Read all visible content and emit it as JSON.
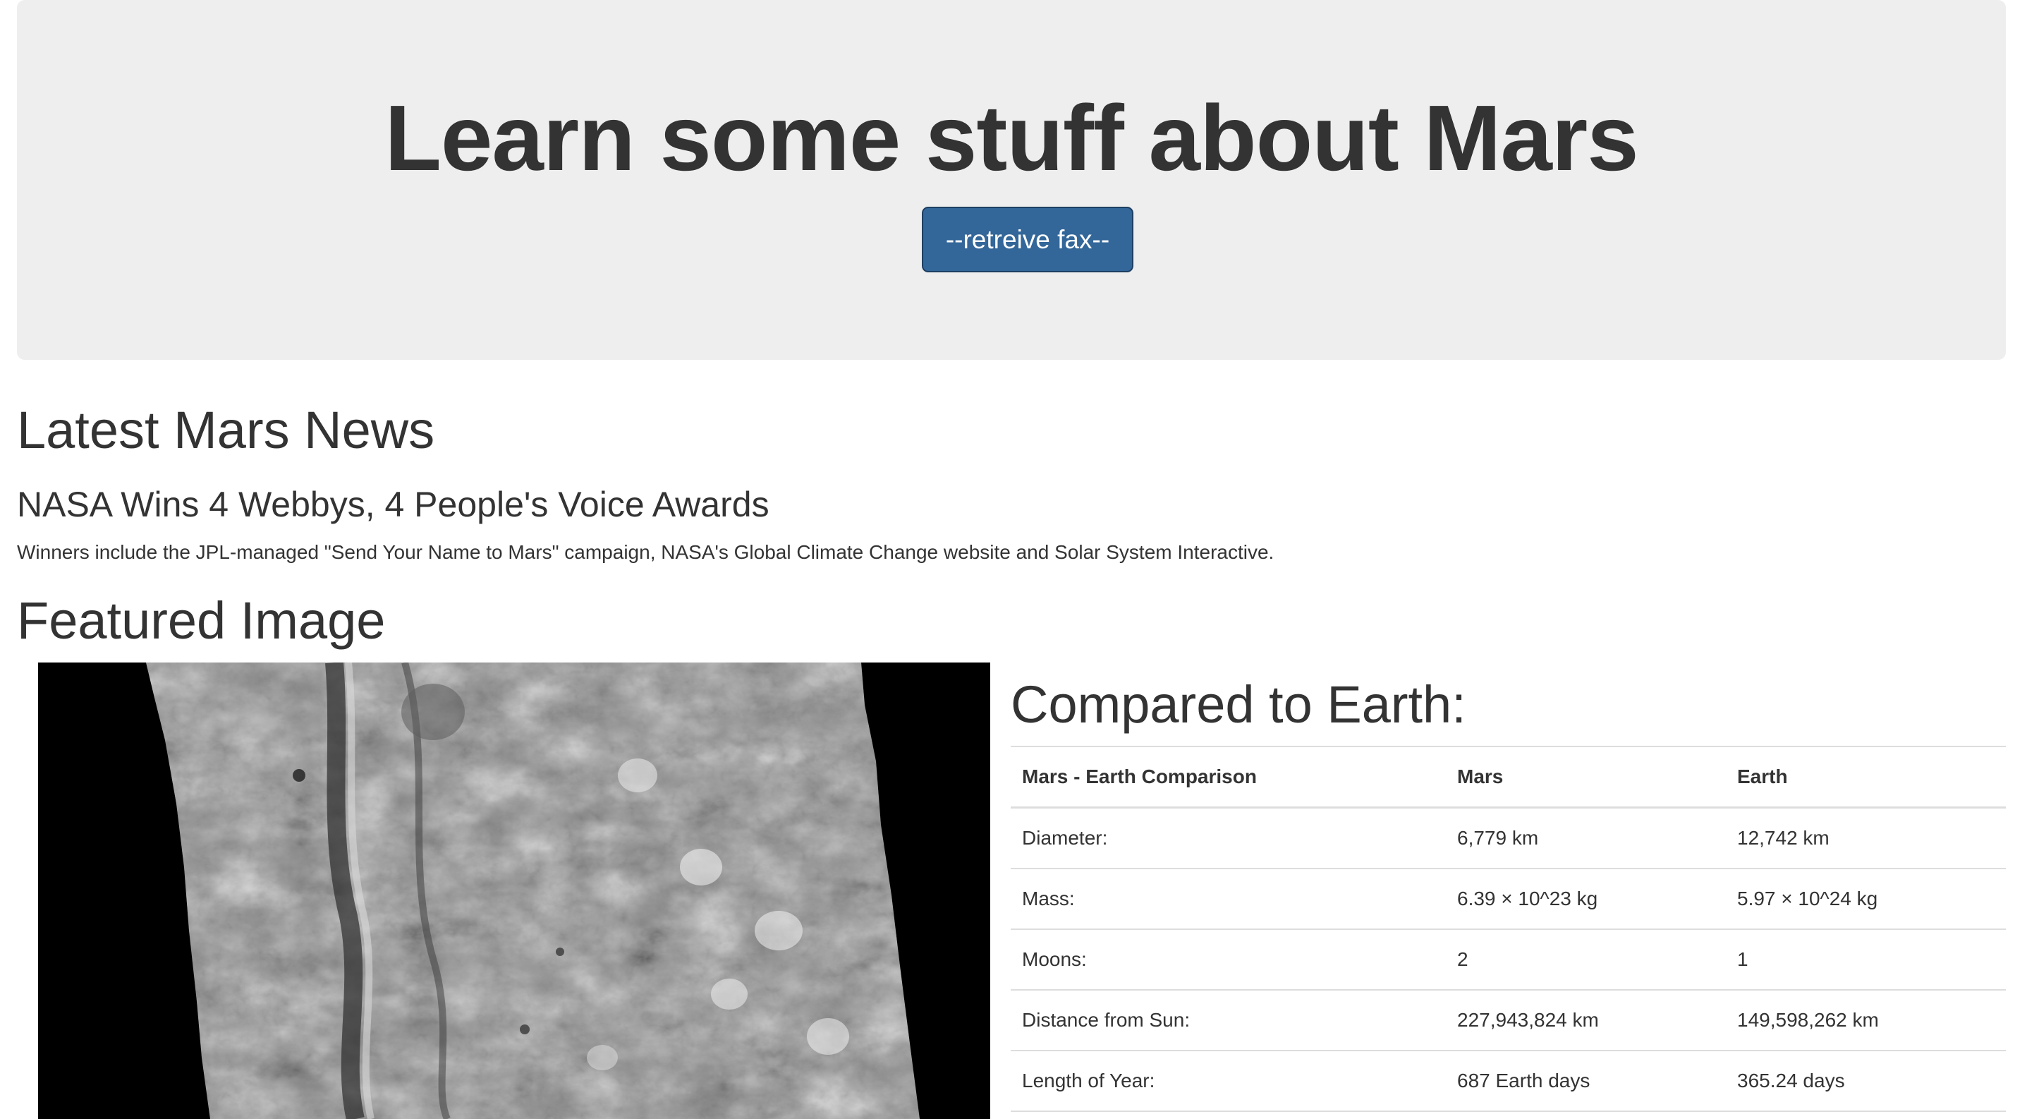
{
  "jumbotron": {
    "title": "Learn some stuff about Mars",
    "button_label": "--retreive fax--",
    "button_color": "#336699",
    "background": "#eeeeee"
  },
  "news": {
    "section_title": "Latest Mars News",
    "headline": "NASA Wins 4 Webbys, 4 People's Voice Awards",
    "teaser": "Winners include the JPL-managed \"Send Your Name to Mars\" campaign, NASA's Global Climate Change website and Solar System Interactive."
  },
  "featured": {
    "section_title": "Featured Image",
    "image_subject": "grayscale-mars-surface-photo"
  },
  "facts": {
    "section_title": "Compared to Earth:",
    "headers": [
      "Mars - Earth Comparison",
      "Mars",
      "Earth"
    ],
    "rows": [
      [
        "Diameter:",
        "6,779 km",
        "12,742 km"
      ],
      [
        "Mass:",
        "6.39 × 10^23 kg",
        "5.97 × 10^24 kg"
      ],
      [
        "Moons:",
        "2",
        "1"
      ],
      [
        "Distance from Sun:",
        "227,943,824 km",
        "149,598,262 km"
      ],
      [
        "Length of Year:",
        "687 Earth days",
        "365.24 days"
      ]
    ]
  }
}
